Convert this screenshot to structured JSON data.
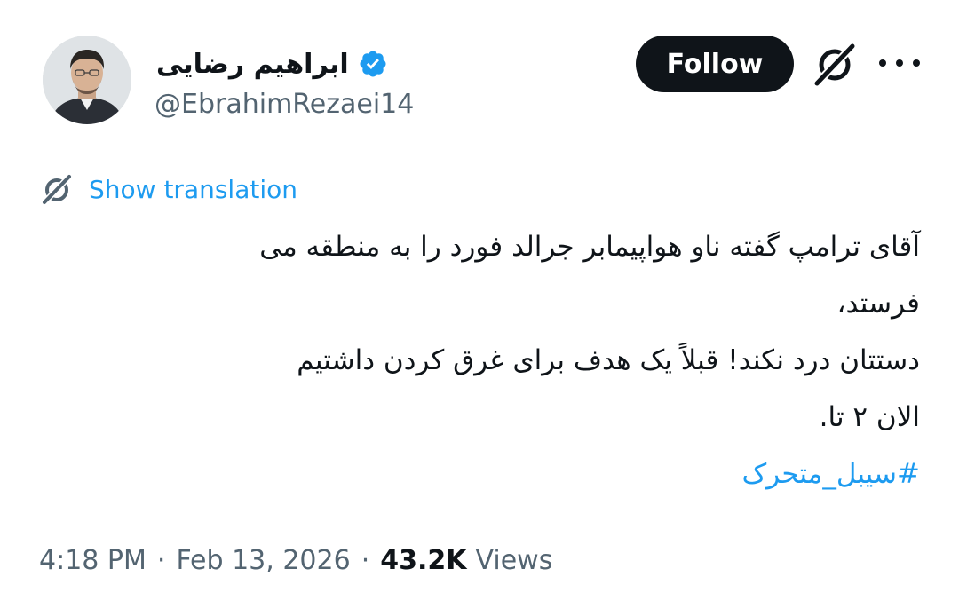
{
  "author": {
    "display_name": "ابراهیم رضایی",
    "handle": "@EbrahimRezaei14",
    "verified": true,
    "avatar_icon": "avatar-photo",
    "verified_icon": "verified-badge-icon"
  },
  "header": {
    "follow_label": "Follow",
    "grok_icon": "grok-icon",
    "more_icon": "more-icon"
  },
  "translation": {
    "icon": "translate-icon",
    "label": "Show translation"
  },
  "tweet": {
    "lines": [
      "آقای ترامپ گفته ناو هواپیمابر جرالد فورد را به منطقه می",
      "فرستد،",
      "دستتان درد نکند! قبلاً یک هدف برای غرق کردن داشتیم",
      "الان ۲ تا."
    ],
    "hashtag": "#سیبل_متحرک"
  },
  "meta": {
    "time": "4:18 PM",
    "separator": "·",
    "date": "Feb 13, 2026",
    "views_count": "43.2K",
    "views_label": "Views"
  },
  "colors": {
    "text": "#0f1419",
    "secondary": "#536471",
    "accent": "#1d9bf0",
    "follow_bg": "#0f1419"
  }
}
